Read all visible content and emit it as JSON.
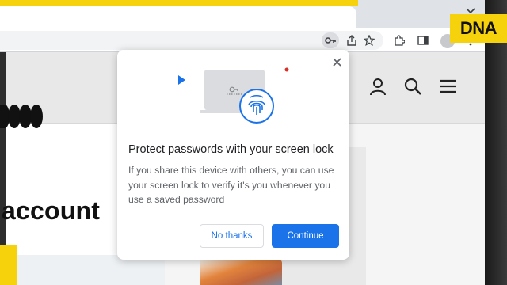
{
  "dialog": {
    "title": "Protect passwords with your screen lock",
    "body": "If you share this device with others, you can use your screen lock to verify it's you whenever you use a saved password",
    "no_thanks_label": "No thanks",
    "continue_label": "Continue",
    "close_icon": "close-icon"
  },
  "site": {
    "heading_fragment": "account"
  },
  "badge": {
    "text": "DNA"
  },
  "colors": {
    "accent": "#1a73e8",
    "badge_yellow": "#f5d20c",
    "text_primary": "#202124",
    "text_secondary": "#5f6368"
  },
  "toolbar_icons": [
    "key-icon",
    "share-icon",
    "star-icon",
    "extensions-icon",
    "sidepanel-icon",
    "more-icon"
  ],
  "header_icons": [
    "account-icon",
    "search-icon",
    "menu-icon"
  ]
}
